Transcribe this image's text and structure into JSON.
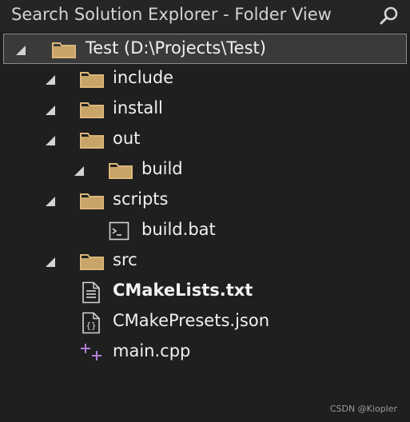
{
  "search": {
    "placeholder": "Search Solution Explorer - Folder View"
  },
  "tree": {
    "root": {
      "label": "Test (D:\\Projects\\Test)"
    },
    "items": [
      {
        "label": "include",
        "icon": "folder-icon"
      },
      {
        "label": "install",
        "icon": "folder-icon"
      },
      {
        "label": "out",
        "icon": "folder-icon"
      },
      {
        "label": "build",
        "icon": "folder-icon"
      },
      {
        "label": "scripts",
        "icon": "folder-icon"
      },
      {
        "label": "build.bat",
        "icon": "batch-file-icon"
      },
      {
        "label": "src",
        "icon": "folder-icon"
      },
      {
        "label": "CMakeLists.txt",
        "icon": "text-file-icon"
      },
      {
        "label": "CMakePresets.json",
        "icon": "json-file-icon"
      },
      {
        "label": "main.cpp",
        "icon": "cpp-file-icon"
      }
    ]
  },
  "watermark": "CSDN @Kiopler",
  "colors": {
    "background": "#1f1f1f",
    "folder": "#dcb67a",
    "cpp_accent": "#b180d7",
    "selection_border": "#8a8a8a"
  }
}
